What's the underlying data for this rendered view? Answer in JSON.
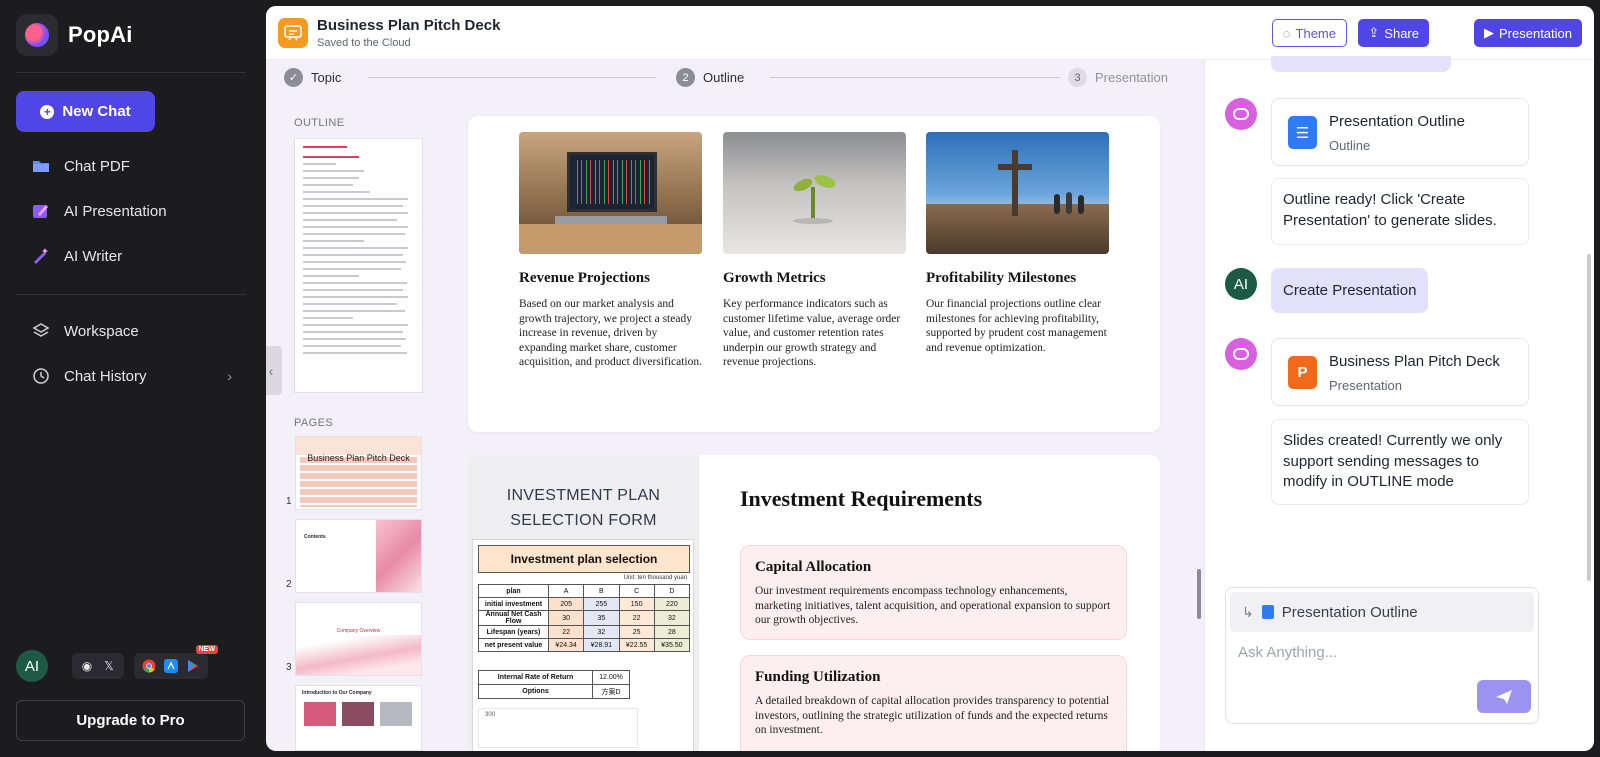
{
  "app": {
    "name": "PopAi"
  },
  "sidebar": {
    "new_chat": "New Chat",
    "items": [
      {
        "label": "Chat PDF",
        "icon": "folder-icon"
      },
      {
        "label": "AI Presentation",
        "icon": "presentation-icon"
      },
      {
        "label": "AI Writer",
        "icon": "magic-wand-icon"
      },
      {
        "label": "Workspace",
        "icon": "layers-icon"
      },
      {
        "label": "Chat History",
        "icon": "history-icon"
      }
    ],
    "user_initials": "AI",
    "new_badge": "NEW",
    "upgrade": "Upgrade to Pro"
  },
  "topbar": {
    "title": "Business Plan Pitch Deck",
    "subtitle": "Saved to the Cloud",
    "theme_label": "Theme",
    "share_label": "Share",
    "presentation_label": "Presentation"
  },
  "stepper": [
    {
      "num": "✓",
      "label": "Topic"
    },
    {
      "num": "2",
      "label": "Outline"
    },
    {
      "num": "3",
      "label": "Presentation"
    }
  ],
  "left_panel": {
    "outline_label": "OUTLINE",
    "pages_label": "PAGES",
    "page_numbers": [
      "1",
      "2",
      "3"
    ],
    "page1_title": "Business Plan Pitch Deck",
    "page2_title": "Contents",
    "page3_title": "Company Overview",
    "page4_title": "Introduction to Our Company"
  },
  "slide1": {
    "columns": [
      {
        "title": "Revenue Projections",
        "text": "Based on our market analysis and growth trajectory, we project a steady increase in revenue, driven by expanding market share, customer acquisition, and product diversification."
      },
      {
        "title": "Growth Metrics",
        "text": "Key performance indicators such as customer lifetime value, average order value, and customer retention rates underpin our growth strategy and revenue projections."
      },
      {
        "title": "Profitability Milestones",
        "text": "Our financial projections outline clear milestones for achieving profitability, supported by prudent cost management and revenue optimization."
      }
    ]
  },
  "slide2": {
    "left_title_1": "INVESTMENT PLAN",
    "left_title_2": "SELECTION FORM",
    "form": {
      "head": "Investment plan selection",
      "unit": "Unit: ten thousand yuan",
      "columns": [
        "plan",
        "A",
        "B",
        "C",
        "D"
      ],
      "rows": [
        [
          "initial investment",
          "205",
          "255",
          "150",
          "220"
        ],
        [
          "Annual Net Cash Flow",
          "30",
          "35",
          "22",
          "32"
        ],
        [
          "Lifespan (years)",
          "22",
          "32",
          "25",
          "28"
        ],
        [
          "net present value",
          "¥24.34",
          "¥28.91",
          "¥22.55",
          "¥35.50"
        ]
      ],
      "irr_label": "Internal Rate of Return",
      "irr_value": "12.00%",
      "options_label": "Options",
      "options_value": "方案D",
      "chart_tick": "300"
    },
    "heading": "Investment Requirements",
    "cards": [
      {
        "title": "Capital Allocation",
        "text": "Our investment requirements encompass technology enhancements, marketing initiatives, talent acquisition, and operational expansion to support our growth objectives."
      },
      {
        "title": "Funding Utilization",
        "text": "A detailed breakdown of capital allocation provides transparency to potential investors, outlining the strategic utilization of funds and the expected returns on investment."
      }
    ]
  },
  "chat": {
    "messages": [
      {
        "card_title": "Presentation Outline",
        "card_sub": "Outline"
      },
      {
        "text": "Outline ready! Click 'Create Presentation' to generate slides."
      },
      {
        "user_initials": "AI",
        "text": "Create Presentation"
      },
      {
        "card_title": "Business Plan Pitch Deck",
        "card_sub": "Presentation",
        "card_letter": "P"
      },
      {
        "text": "Slides created! Currently we only support sending messages to modify in OUTLINE mode"
      }
    ],
    "context_label": "Presentation Outline",
    "input_placeholder": "Ask Anything..."
  },
  "colors": {
    "accent": "#4f46e5",
    "orange": "#f59a1c",
    "bot": "#d860e0",
    "user": "#1c5a45"
  }
}
